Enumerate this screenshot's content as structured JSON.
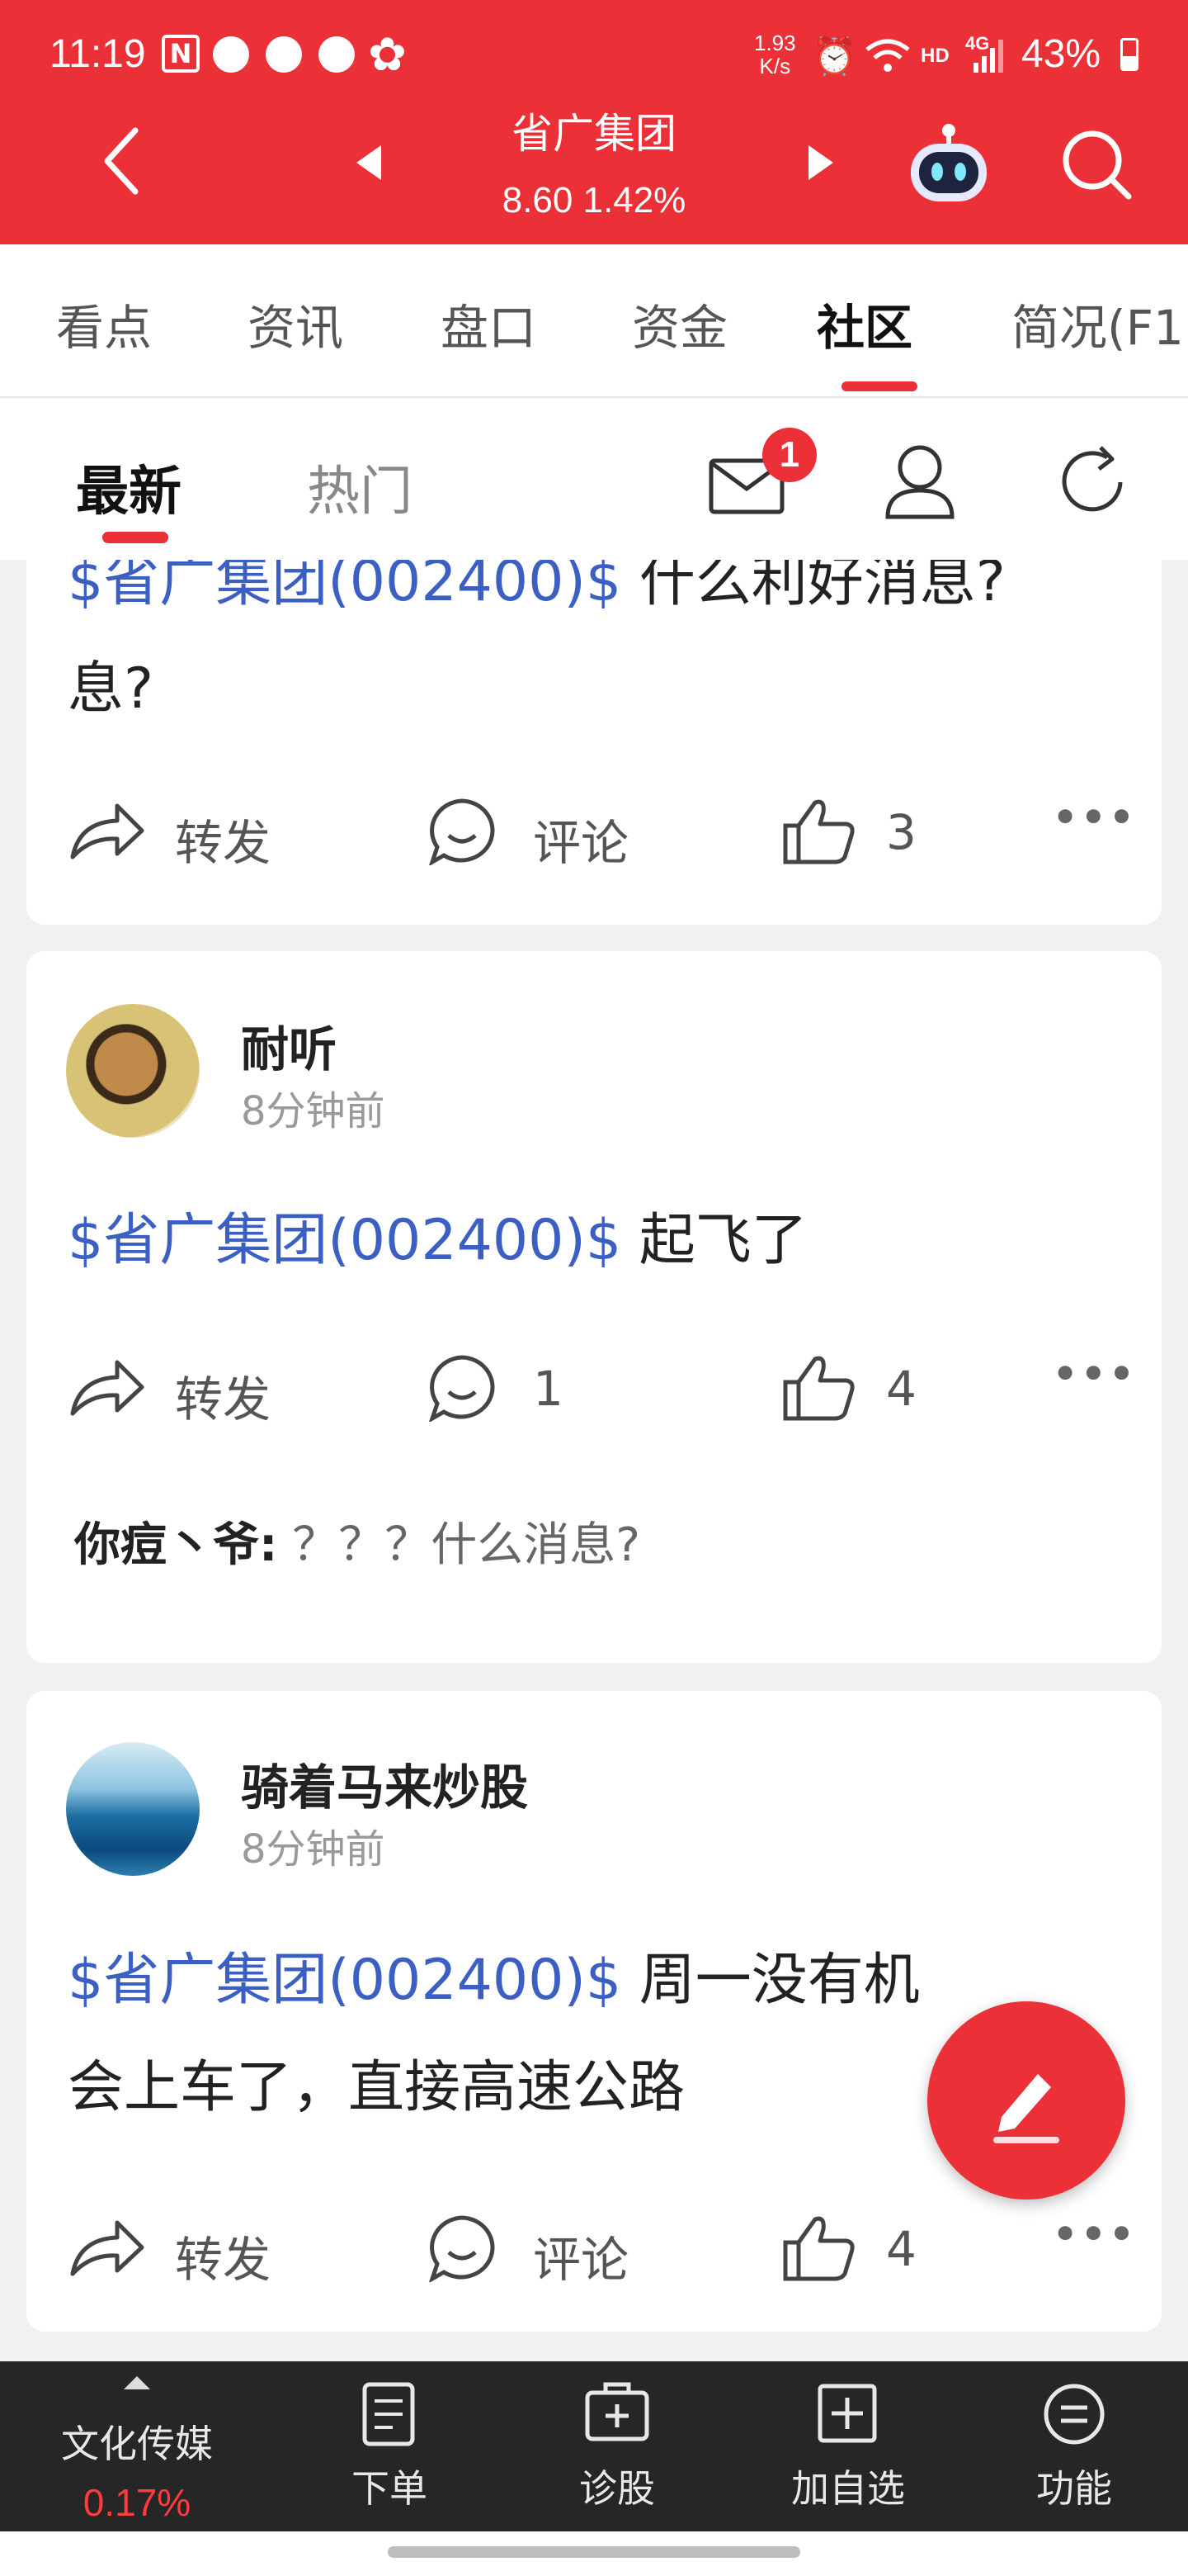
{
  "status_bar": {
    "time": "11:19",
    "net_speed_top": "1.93",
    "net_speed_unit": "K/s",
    "hd_label": "HD",
    "network_label": "4G",
    "battery": "43%"
  },
  "header": {
    "title": "省广集团",
    "price_line": "8.60 1.42%"
  },
  "tabs": [
    "看点",
    "资讯",
    "盘口",
    "资金",
    "社区",
    "简况(F1"
  ],
  "active_tab": 4,
  "subnav": {
    "latest": "最新",
    "hot": "热门",
    "mail_badge": "1"
  },
  "posts": [
    {
      "text_ticker": "$省广集团(002400)$",
      "text_body": " 什么利好消息?",
      "line2": "息?",
      "repost": "转发",
      "comment": "评论",
      "likes": "3"
    },
    {
      "username": "耐听",
      "time": "8分钟前",
      "text_ticker": "$省广集团(002400)$",
      "text_body": " 起飞了",
      "repost": "转发",
      "comment": "1",
      "likes": "4",
      "reply_user": "你痘丶爷:",
      "reply_text": " ？？？什么消息?"
    },
    {
      "username": "骑着马来炒股",
      "time": "8分钟前",
      "text_ticker": "$省广集团(002400)$",
      "text_body": " 周一没有机",
      "line2": "会上车了，直接高速公路",
      "repost": "转发",
      "comment": "评论",
      "likes": "4"
    }
  ],
  "bottom_nav": {
    "sector_name": "文化传媒",
    "sector_change": "0.17%",
    "items": [
      "下单",
      "诊股",
      "加自选",
      "功能"
    ]
  },
  "colors": {
    "brand_red": "#ec3038",
    "ticker_blue": "#3c5fc4",
    "bottom_bg": "#262626"
  }
}
